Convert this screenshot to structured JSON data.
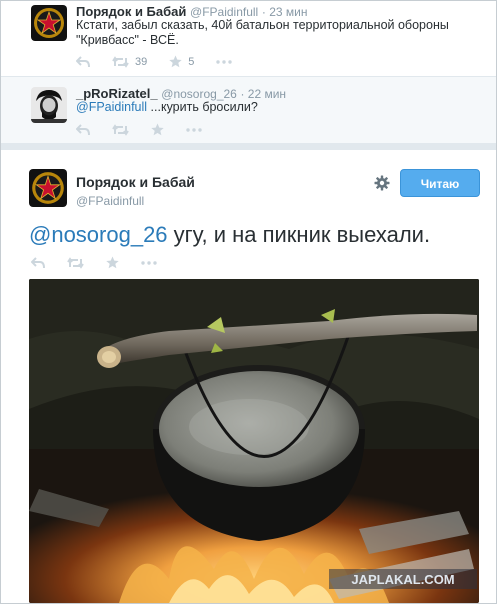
{
  "tweet1": {
    "name": "Порядок и Бабай",
    "handle": "@FPaidinfull",
    "time": "· 23 мин",
    "text_line1": "Кстати, забыл сказать, 40й батальон территориальной обороны",
    "text_line2": "\"Кривбасс\" - ВСЁ.",
    "retweets": "39",
    "favorites": "5"
  },
  "tweet2": {
    "name": "_pRoRizatel_",
    "handle": "@nosorog_26",
    "time": "· 22 мин",
    "mention": "@FPaidinfull",
    "text": " ...курить бросили?"
  },
  "tweet3": {
    "name": "Порядок и Бабай",
    "handle": "@FPaidinfull",
    "follow_label": "Читаю",
    "mention": "@nosorog_26",
    "text": " угу, и на пикник выехали."
  },
  "watermark": "JAPLAKAL.COM",
  "colors": {
    "link": "#2b7bb9",
    "follow_button": "#55acee",
    "muted": "#8899a6",
    "icon": "#ccd6dd"
  },
  "icons": [
    "reply-icon",
    "retweet-icon",
    "favorite-icon",
    "more-icon",
    "gear-icon"
  ]
}
